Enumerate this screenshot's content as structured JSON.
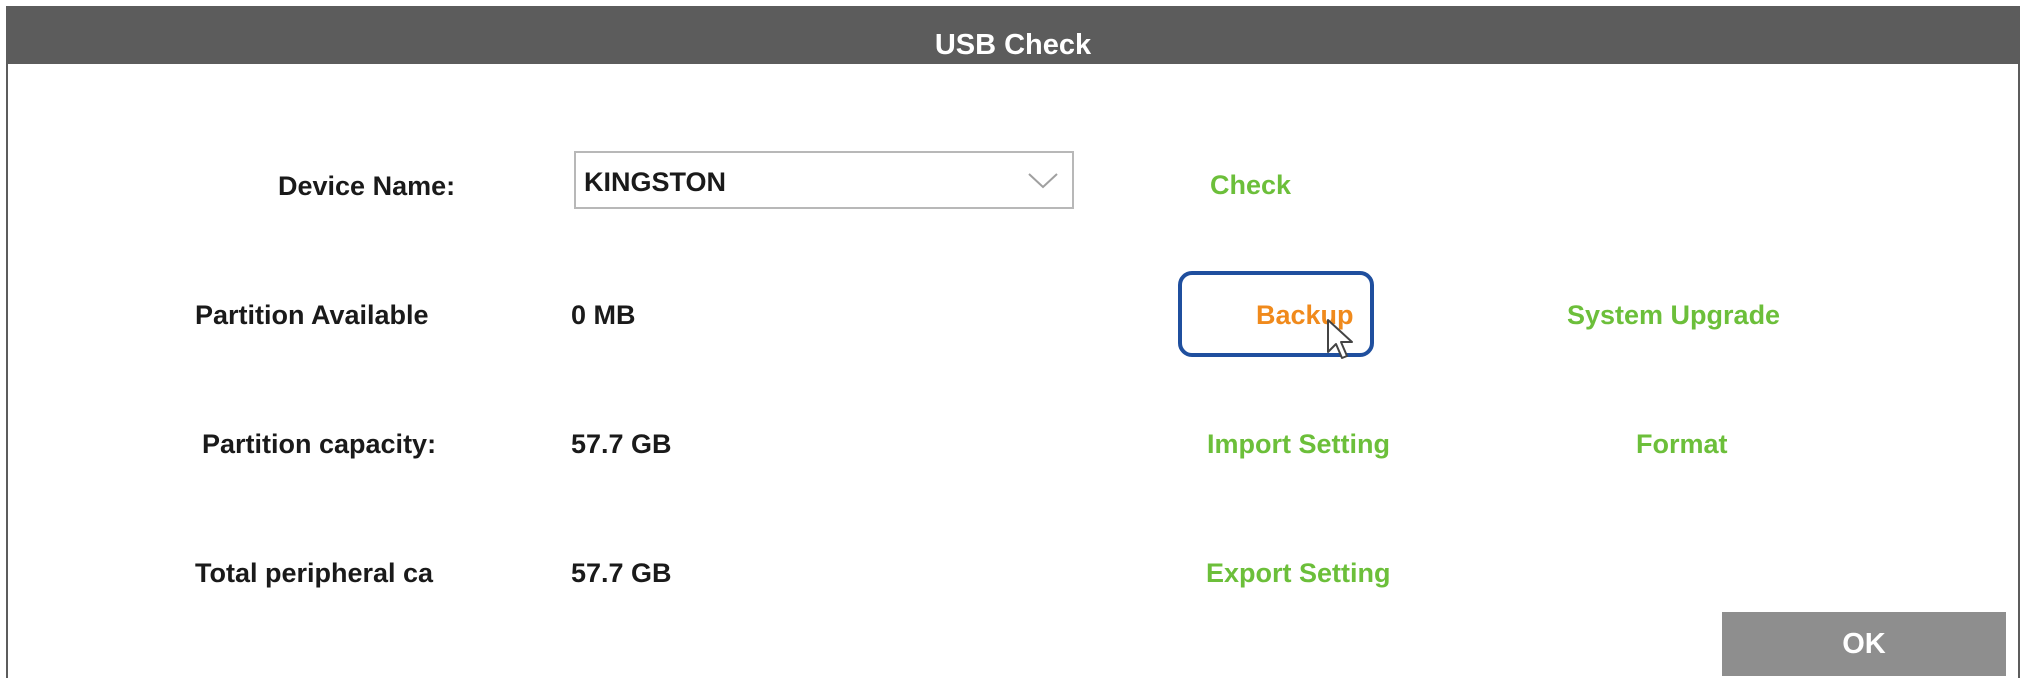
{
  "dialog": {
    "title": "USB Check"
  },
  "fields": {
    "device_name_label": "Device Name:",
    "device_name_value": "KINGSTON",
    "partition_available_label": "Partition Available",
    "partition_available_value": "0 MB",
    "partition_capacity_label": "Partition capacity:",
    "partition_capacity_value": "57.7 GB",
    "total_peripheral_label": "Total peripheral ca",
    "total_peripheral_value": "57.7 GB"
  },
  "actions": {
    "check": "Check",
    "backup": "Backup",
    "system_upgrade": "System Upgrade",
    "import_setting": "Import Setting",
    "format": "Format",
    "export_setting": "Export Setting",
    "ok": "OK"
  },
  "icons": {
    "dropdown": "chevron-down-icon",
    "cursor": "mouse-pointer-icon"
  },
  "colors": {
    "titlebar": "#5c5c5c",
    "action_text": "#6cbf3a",
    "active_action_text": "#f08a1c",
    "focus_ring": "#1f4f9e",
    "ok_button": "#8e8e8e"
  }
}
